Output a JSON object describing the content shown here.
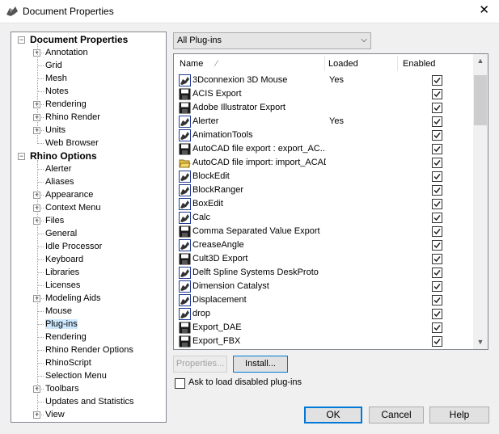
{
  "window": {
    "title": "Document Properties",
    "close_glyph": "✕"
  },
  "tree": {
    "items": [
      {
        "label": "Document Properties",
        "level": 0,
        "bold": true,
        "expander": "-"
      },
      {
        "label": "Annotation",
        "level": 1,
        "expander": "+"
      },
      {
        "label": "Grid",
        "level": 1
      },
      {
        "label": "Mesh",
        "level": 1
      },
      {
        "label": "Notes",
        "level": 1
      },
      {
        "label": "Rendering",
        "level": 1,
        "expander": "+"
      },
      {
        "label": "Rhino Render",
        "level": 1,
        "expander": "+"
      },
      {
        "label": "Units",
        "level": 1,
        "expander": "+"
      },
      {
        "label": "Web Browser",
        "level": 1
      },
      {
        "label": "Rhino Options",
        "level": 0,
        "bold": true,
        "expander": "-"
      },
      {
        "label": "Alerter",
        "level": 1
      },
      {
        "label": "Aliases",
        "level": 1
      },
      {
        "label": "Appearance",
        "level": 1,
        "expander": "+"
      },
      {
        "label": "Context Menu",
        "level": 1,
        "expander": "+"
      },
      {
        "label": "Files",
        "level": 1,
        "expander": "+"
      },
      {
        "label": "General",
        "level": 1
      },
      {
        "label": "Idle Processor",
        "level": 1
      },
      {
        "label": "Keyboard",
        "level": 1
      },
      {
        "label": "Libraries",
        "level": 1
      },
      {
        "label": "Licenses",
        "level": 1
      },
      {
        "label": "Modeling Aids",
        "level": 1,
        "expander": "+"
      },
      {
        "label": "Mouse",
        "level": 1
      },
      {
        "label": "Plug-ins",
        "level": 1,
        "selected": true
      },
      {
        "label": "Rendering",
        "level": 1
      },
      {
        "label": "Rhino Render Options",
        "level": 1
      },
      {
        "label": "RhinoScript",
        "level": 1
      },
      {
        "label": "Selection Menu",
        "level": 1
      },
      {
        "label": "Toolbars",
        "level": 1,
        "expander": "+"
      },
      {
        "label": "Updates and Statistics",
        "level": 1
      },
      {
        "label": "View",
        "level": 1,
        "expander": "+"
      }
    ]
  },
  "filter": {
    "selected": "All Plug-ins",
    "arrow_glyph": "⌵"
  },
  "table": {
    "columns": {
      "name": "Name",
      "sort_glyph": "⁄",
      "loaded": "Loaded",
      "enabled": "Enabled"
    },
    "rows": [
      {
        "name": "3Dconnexion 3D Mouse",
        "loaded": "Yes",
        "enabled": true,
        "icon": "plugin-icon"
      },
      {
        "name": "ACIS Export",
        "loaded": "",
        "enabled": true,
        "icon": "save-disk-icon"
      },
      {
        "name": "Adobe Illustrator Export",
        "loaded": "",
        "enabled": true,
        "icon": "save-disk-icon"
      },
      {
        "name": "Alerter",
        "loaded": "Yes",
        "enabled": true,
        "icon": "plugin-icon"
      },
      {
        "name": "AnimationTools",
        "loaded": "",
        "enabled": true,
        "icon": "plugin-icon"
      },
      {
        "name": "AutoCAD file export : export_AC...",
        "loaded": "",
        "enabled": true,
        "icon": "save-disk-icon"
      },
      {
        "name": "AutoCAD file import: import_ACAD",
        "loaded": "",
        "enabled": true,
        "icon": "open-folder-icon"
      },
      {
        "name": "BlockEdit",
        "loaded": "",
        "enabled": true,
        "icon": "plugin-icon"
      },
      {
        "name": "BlockRanger",
        "loaded": "",
        "enabled": true,
        "icon": "plugin-icon"
      },
      {
        "name": "BoxEdit",
        "loaded": "",
        "enabled": true,
        "icon": "plugin-icon"
      },
      {
        "name": "Calc",
        "loaded": "",
        "enabled": true,
        "icon": "plugin-icon"
      },
      {
        "name": "Comma Separated Value Export",
        "loaded": "",
        "enabled": true,
        "icon": "save-disk-icon"
      },
      {
        "name": "CreaseAngle",
        "loaded": "",
        "enabled": true,
        "icon": "plugin-icon"
      },
      {
        "name": "Cult3D Export",
        "loaded": "",
        "enabled": true,
        "icon": "save-disk-icon"
      },
      {
        "name": "Delft Spline Systems DeskProto",
        "loaded": "",
        "enabled": true,
        "icon": "plugin-icon"
      },
      {
        "name": "Dimension Catalyst",
        "loaded": "",
        "enabled": true,
        "icon": "plugin-icon"
      },
      {
        "name": "Displacement",
        "loaded": "",
        "enabled": true,
        "icon": "plugin-icon"
      },
      {
        "name": "drop",
        "loaded": "",
        "enabled": true,
        "icon": "plugin-icon"
      },
      {
        "name": "Export_DAE",
        "loaded": "",
        "enabled": true,
        "icon": "save-disk-icon"
      },
      {
        "name": "Export_FBX",
        "loaded": "",
        "enabled": true,
        "icon": "save-disk-icon"
      }
    ],
    "scroll_up_glyph": "▲",
    "scroll_down_glyph": "▼"
  },
  "buttons": {
    "properties": "Properties...",
    "install": "Install...",
    "ok": "OK",
    "cancel": "Cancel",
    "help": "Help"
  },
  "ask_disabled": {
    "label": "Ask to load disabled plug-ins",
    "checked": false
  }
}
